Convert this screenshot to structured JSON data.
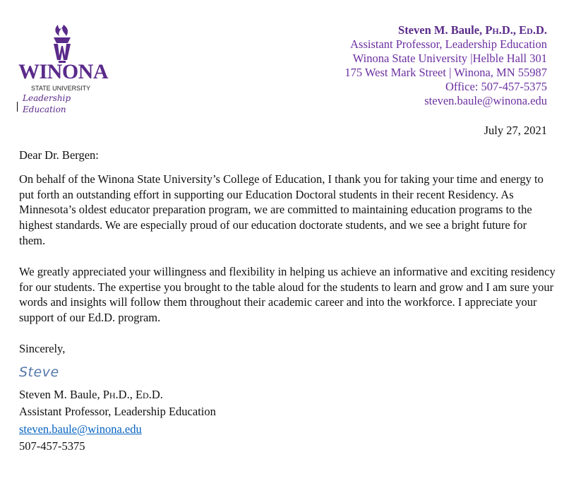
{
  "logo": {
    "wordmark": "WINONA",
    "subtitle": "STATE UNIVERSITY",
    "program": "Leadership Education",
    "color": "#5a2a8a"
  },
  "letterhead": {
    "name_prefix": "Steven M. Baule, ",
    "degree1": "Ph.D.",
    "sep": ", ",
    "degree2": "Ed.D.",
    "title": "Assistant Professor, Leadership Education",
    "address1": "Winona State University |Helble Hall 301",
    "address2": "175 West Mark Street | Winona, MN  55987",
    "office": "Office: 507-457-5375",
    "email": "steven.baule@winona.edu",
    "color": "#6b2fa0"
  },
  "date": "July 27, 2021",
  "salutation": "Dear Dr. Bergen:",
  "paragraphs": [
    "On behalf of the Winona State University’s College of Education, I thank you for taking your time and energy to put forth an outstanding effort in supporting our Education Doctoral students in their recent Residency. As Minnesota’s oldest educator preparation program, we are committed to maintaining education programs to the highest standards. We are especially proud of our education doctorate students, and we see a bright future for them.",
    "We greatly appreciated your willingness and flexibility in helping us achieve an informative and exciting residency for our students. The expertise you brought to the table aloud for the students to learn and grow and I am sure your words and insights will follow them throughout their academic career and into the workforce. I appreciate your support of our Ed.D. program."
  ],
  "closing": "Sincerely,",
  "signature": "Steve",
  "sig_block": {
    "name_prefix": "Steven M. Baule, ",
    "degree1": "Ph.D.",
    "sep": ", ",
    "degree2": "Ed.D.",
    "title": "Assistant Professor, Leadership Education",
    "email": "steven.baule@winona.edu",
    "phone": "507-457-5375",
    "link_color": "#0563c1"
  }
}
